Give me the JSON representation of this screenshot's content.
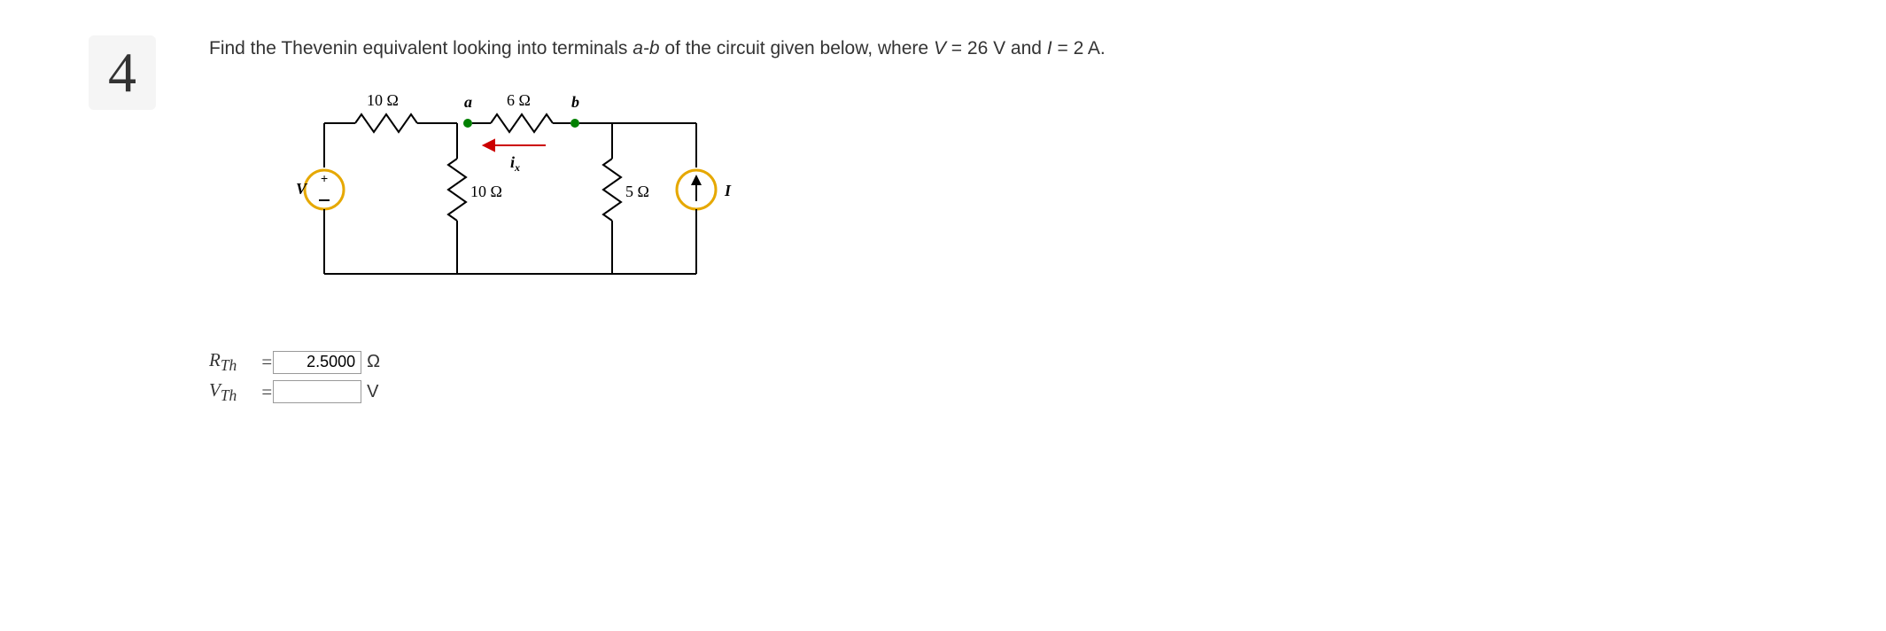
{
  "question_number": "4",
  "prompt": {
    "text_1": "Find the Thevenin equivalent looking into terminals ",
    "ab": "a-b",
    "text_2": " of the circuit given below, where ",
    "V_sym": "V",
    "eq1": " = 26 V and ",
    "I_sym": "I",
    "eq2": " = 2 A."
  },
  "circuit": {
    "r_top_left": "10 Ω",
    "r_top_mid": "6 Ω",
    "r_vert_mid": "10 Ω",
    "r_vert_right": "5 Ω",
    "node_a": "a",
    "node_b": "b",
    "ix": "i",
    "ix_sub": "x",
    "V_label": "V",
    "I_label": "I",
    "plus": "+",
    "minus": "−"
  },
  "answers": {
    "rth_label": "R",
    "rth_sub": "Th",
    "rth_eq": " = ",
    "rth_value": "2.5000",
    "rth_unit": "Ω",
    "vth_label": "V",
    "vth_sub": "Th",
    "vth_eq": " = ",
    "vth_value": "",
    "vth_unit": "V"
  }
}
